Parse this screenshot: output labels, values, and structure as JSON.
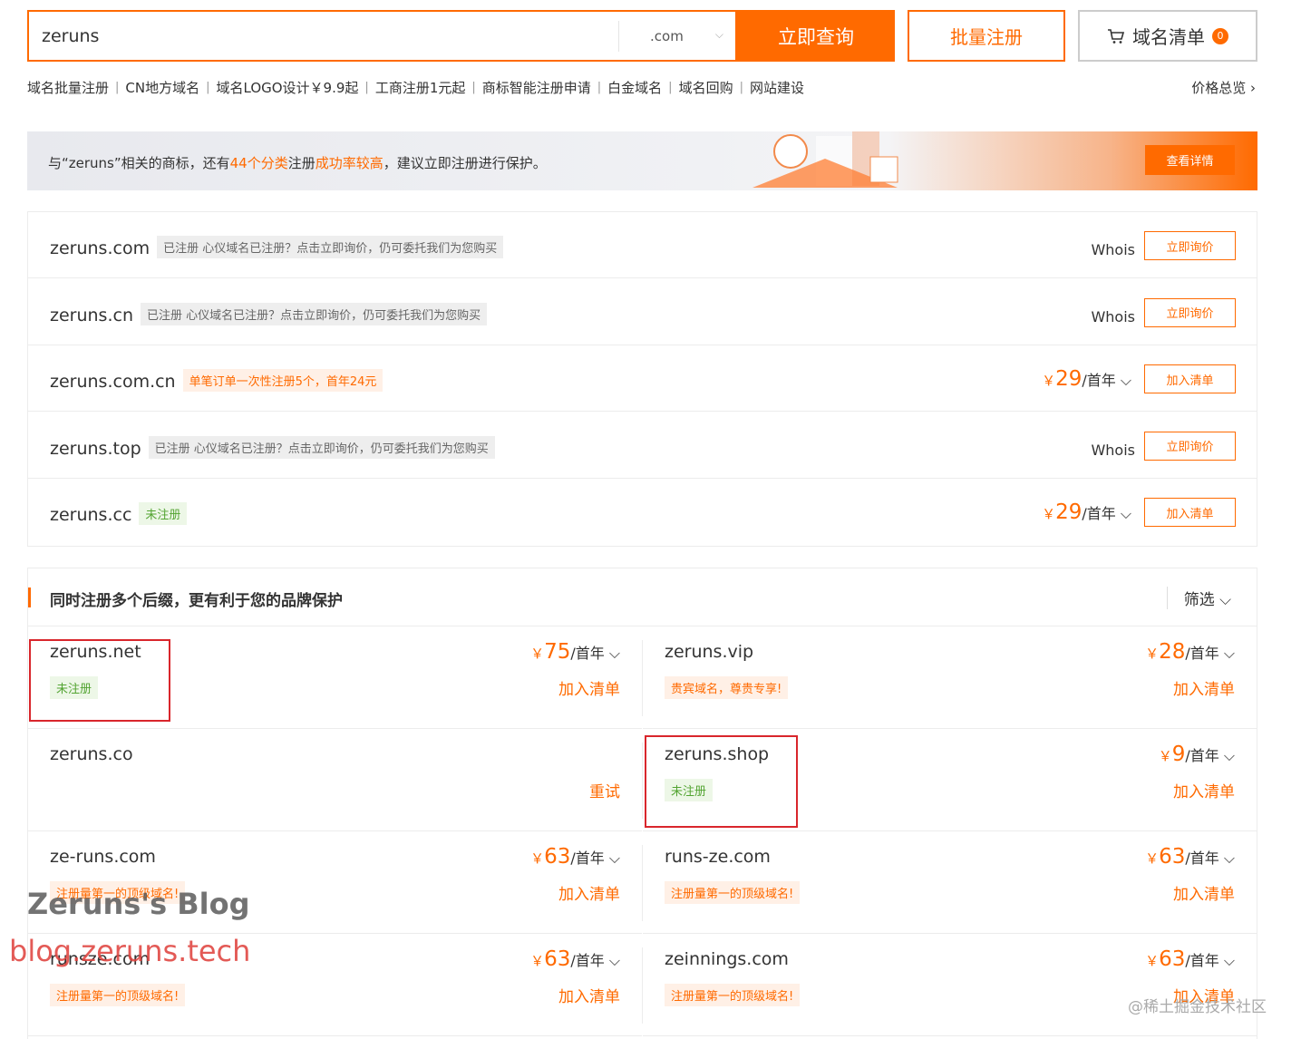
{
  "search": {
    "value": "zeruns",
    "suffix": ".com",
    "query_btn": "立即查询",
    "bulk_btn": "批量注册",
    "cart_btn": "域名清单",
    "cart_count": "0"
  },
  "links": [
    "域名批量注册",
    "CN地方域名",
    "域名LOGO设计￥9.9起",
    "工商注册1元起",
    "商标智能注册申请",
    "白金域名",
    "域名回购",
    "网站建设"
  ],
  "price_overview": "价格总览",
  "banner": {
    "prefix": "与“zeruns”相关的商标，还有",
    "hl1": "44个分类",
    "mid": "注册",
    "hl2": "成功率较高",
    "suffix": "，建议立即注册进行保护。",
    "btn": "查看详情"
  },
  "results": [
    {
      "domain": "zeruns.com",
      "tag": "已注册 心仪域名已注册？点击立即询价，仍可委托我们为您购买",
      "tag_type": "gray",
      "whois": "Whois",
      "action": "立即询价"
    },
    {
      "domain": "zeruns.cn",
      "tag": "已注册 心仪域名已注册？点击立即询价，仍可委托我们为您购买",
      "tag_type": "gray",
      "whois": "Whois",
      "action": "立即询价"
    },
    {
      "domain": "zeruns.com.cn",
      "tag": "单笔订单一次性注册5个，首年24元",
      "tag_type": "orange",
      "yen": "￥",
      "price": "29",
      "unit": "/首年",
      "action": "加入清单"
    },
    {
      "domain": "zeruns.top",
      "tag": "已注册 心仪域名已注册？点击立即询价，仍可委托我们为您购买",
      "tag_type": "gray",
      "whois": "Whois",
      "action": "立即询价"
    },
    {
      "domain": "zeruns.cc",
      "tag": "未注册",
      "tag_type": "green",
      "yen": "￥",
      "price": "29",
      "unit": "/首年",
      "action": "加入清单"
    }
  ],
  "suggest": {
    "title": "同时注册多个后缀，更有利于您的品牌保护",
    "filter": "筛选",
    "items": [
      {
        "domain": "zeruns.net",
        "tag": "未注册",
        "tag_type": "green",
        "yen": "￥",
        "price": "75",
        "unit": "/首年",
        "action": "加入清单"
      },
      {
        "domain": "zeruns.vip",
        "tag": "贵宾域名，尊贵专享!",
        "tag_type": "orange",
        "yen": "￥",
        "price": "28",
        "unit": "/首年",
        "action": "加入清单"
      },
      {
        "domain": "zeruns.co",
        "action": "重试"
      },
      {
        "domain": "zeruns.shop",
        "tag": "未注册",
        "tag_type": "green",
        "yen": "￥",
        "price": "9",
        "unit": "/首年",
        "action": "加入清单"
      },
      {
        "domain": "ze-runs.com",
        "tag": "注册量第一的顶级域名!",
        "tag_type": "orange",
        "yen": "￥",
        "price": "63",
        "unit": "/首年",
        "action": "加入清单"
      },
      {
        "domain": "runs-ze.com",
        "tag": "注册量第一的顶级域名!",
        "tag_type": "orange",
        "yen": "￥",
        "price": "63",
        "unit": "/首年",
        "action": "加入清单"
      },
      {
        "domain": "runsze.com",
        "tag": "注册量第一的顶级域名!",
        "tag_type": "orange",
        "yen": "￥",
        "price": "63",
        "unit": "/首年",
        "action": "加入清单"
      },
      {
        "domain": "zeinnings.com",
        "tag": "注册量第一的顶级域名!",
        "tag_type": "orange",
        "yen": "￥",
        "price": "63",
        "unit": "/首年",
        "action": "加入清单"
      }
    ]
  },
  "watermarks": {
    "blog_name": "Zeruns's Blog",
    "blog_url": "blog.zeruns.tech",
    "community": "@稀土掘金技术社区"
  },
  "colors": {
    "accent": "#ff6a00",
    "highlight_box": "#d9262c"
  }
}
